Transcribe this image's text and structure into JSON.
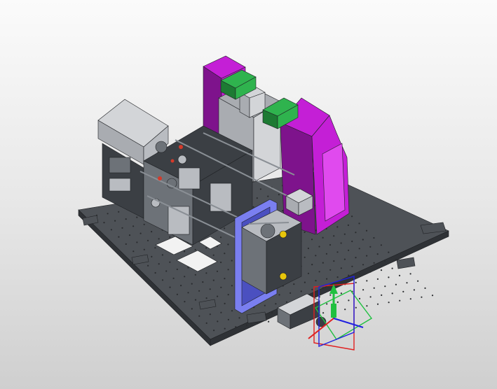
{
  "viewport": {
    "background_top": "#fbfbfb",
    "background_bottom": "#cfcfcf"
  },
  "model": {
    "colors": {
      "base_plate": "#4e5257",
      "base_plate_edge": "#2f3236",
      "hole": "#2a2c2f",
      "machine_dark": "#3b3f44",
      "machine_mid": "#6d7278",
      "machine_light": "#b9bcc1",
      "enclosure_gray": "#a9acb1",
      "enclosure_gray_top": "#d3d5d8",
      "cabinet_magenta": "#c41fd6",
      "cabinet_magenta_dark": "#7e138c",
      "cabinet_magenta_light": "#e04aee",
      "module_green": "#2fb34e",
      "module_green_dark": "#1d7a33",
      "panel_blue": "#7a7ff0",
      "panel_blue_dark": "#4b50c0",
      "accent_yellow": "#e8c60b",
      "accent_red": "#d43a2a"
    }
  },
  "triad": {
    "x_axis_color": "#e02020",
    "y_axis_color": "#20c040",
    "z_axis_color": "#2020e0"
  }
}
